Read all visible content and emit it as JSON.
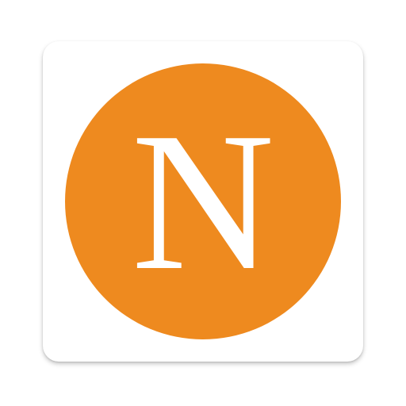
{
  "app_icon": {
    "letter": "N",
    "colors": {
      "tile_background": "#ffffff",
      "circle": "#ee8a1f",
      "letter": "#ffffff"
    }
  }
}
